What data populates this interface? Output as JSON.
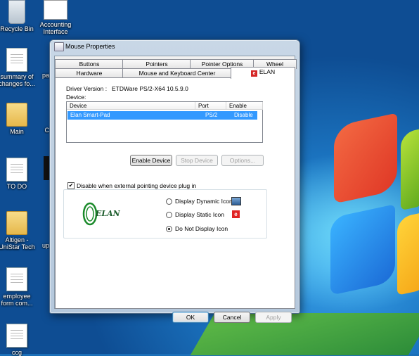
{
  "desktop": {
    "icons": [
      {
        "label": "Recycle Bin"
      },
      {
        "label": "Accounting Interface"
      },
      {
        "label": "summary of changes fo..."
      },
      {
        "label": "pa"
      },
      {
        "label": "Main"
      },
      {
        "label": "C"
      },
      {
        "label": "TO DO"
      },
      {
        "label": "Altigen - UniStar Tech"
      },
      {
        "label": "up"
      },
      {
        "label": "employee form com..."
      },
      {
        "label": "ccg"
      }
    ]
  },
  "window": {
    "title": "Mouse Properties",
    "tabs_row1": [
      "Buttons",
      "Pointers",
      "Pointer Options",
      "Wheel"
    ],
    "tabs_row2": [
      "Hardware",
      "Mouse and Keyboard Center",
      "ELAN"
    ],
    "active_tab": "ELAN",
    "driver_version_label": "Driver Version :",
    "driver_version_value": "ETDWare PS/2-X64 10.5.9.0",
    "device_label": "Device:",
    "device_list": {
      "columns": [
        "Device",
        "Port",
        "Enable"
      ],
      "rows": [
        {
          "device": "Elan Smart-Pad",
          "port": "PS/2",
          "enable": "Disable"
        }
      ]
    },
    "buttons": {
      "enable_device": "Enable Device",
      "stop_device": "Stop Device",
      "options": "Options..."
    },
    "disable_checkbox": {
      "label": "Disable when external pointing device plug in",
      "checked": true
    },
    "display_options": [
      {
        "label": "Display Dynamic Icon",
        "selected": false,
        "icon": "monitor-icon"
      },
      {
        "label": "Display Static Icon",
        "selected": false,
        "icon": "elan-icon"
      },
      {
        "label": "Do Not Display Icon",
        "selected": true
      }
    ],
    "logo_text": "ELAN",
    "footer": {
      "ok": "OK",
      "cancel": "Cancel",
      "apply": "Apply"
    }
  }
}
